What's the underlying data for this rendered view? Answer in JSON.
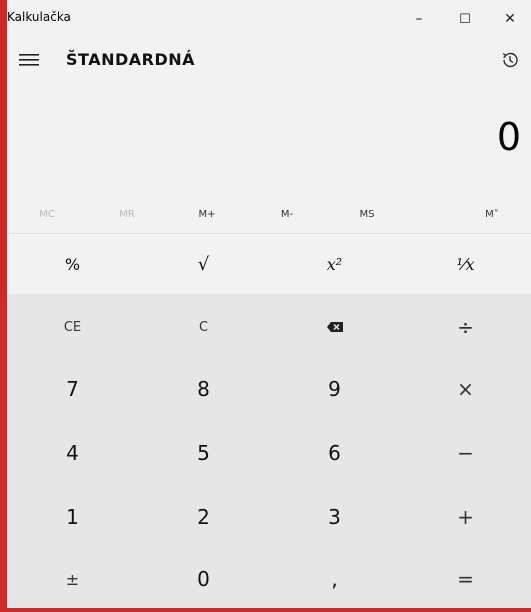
{
  "window": {
    "title": "Kalkulačka",
    "minimize_glyph": "–",
    "maximize_glyph": "☐",
    "close_glyph": "✕"
  },
  "header": {
    "mode_title": "ŠTANDARDNÁ",
    "menu_icon": "hamburger-icon",
    "history_icon": "history-icon"
  },
  "display": {
    "value": "0"
  },
  "memory": {
    "mc": "MC",
    "mr": "MR",
    "mplus": "M+",
    "mminus": "M-",
    "ms": "MS",
    "mlist": "M˅"
  },
  "scientific": {
    "percent": "%",
    "sqrt": "√",
    "square": "x²",
    "reciprocal": "¹⁄x"
  },
  "keys": {
    "ce": "CE",
    "c": "C",
    "backspace_icon": "backspace-icon",
    "divide": "÷",
    "seven": "7",
    "eight": "8",
    "nine": "9",
    "multiply": "×",
    "four": "4",
    "five": "5",
    "six": "6",
    "minus": "−",
    "one": "1",
    "two": "2",
    "three": "3",
    "plus": "+",
    "plusminus": "±",
    "zero": "0",
    "comma": ",",
    "equals": "="
  },
  "colors": {
    "accent_red": "#d0292c",
    "window_bg": "#f2f2f2",
    "keypad_bg": "#e6e6e6"
  }
}
